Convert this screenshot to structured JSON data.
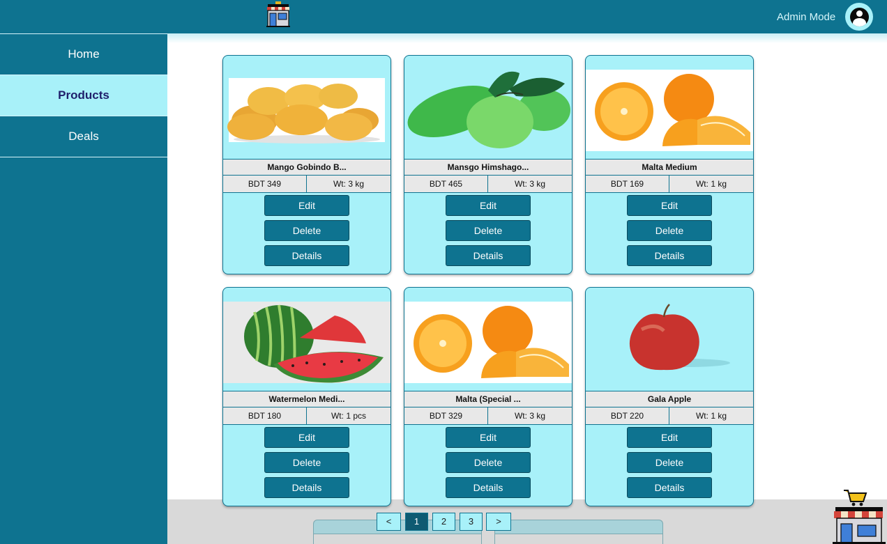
{
  "header": {
    "mode_label": "Admin Mode"
  },
  "sidebar": {
    "items": [
      {
        "label": "Home",
        "active": false
      },
      {
        "label": "Products",
        "active": true
      },
      {
        "label": "Deals",
        "active": false
      }
    ]
  },
  "products": [
    {
      "name": "Mango Gobindo B...",
      "price": "BDT 349",
      "weight": "Wt: 3 kg",
      "image": "yellow-mangoes-image"
    },
    {
      "name": "Mansgo Himshago...",
      "price": "BDT 465",
      "weight": "Wt: 3 kg",
      "image": "green-mangoes-image"
    },
    {
      "name": "Malta Medium",
      "price": "BDT 169",
      "weight": "Wt: 1 kg",
      "image": "oranges-image"
    },
    {
      "name": "Watermelon Medi...",
      "price": "BDT 180",
      "weight": "Wt: 1 pcs",
      "image": "watermelon-image"
    },
    {
      "name": "Malta (Special ...",
      "price": "BDT 329",
      "weight": "Wt: 3 kg",
      "image": "oranges-image"
    },
    {
      "name": "Gala Apple",
      "price": "BDT 220",
      "weight": "Wt: 1 kg",
      "image": "apple-image"
    }
  ],
  "card_actions": {
    "edit": "Edit",
    "delete": "Delete",
    "details": "Details"
  },
  "pagination": {
    "prev": "<",
    "pages": [
      "1",
      "2",
      "3"
    ],
    "current": "1",
    "next": ">"
  },
  "colors": {
    "primary": "#0e7390",
    "card_bg": "#a8f1f9",
    "active_text": "#1f1f6b",
    "row_bg": "#e8e8e8"
  }
}
